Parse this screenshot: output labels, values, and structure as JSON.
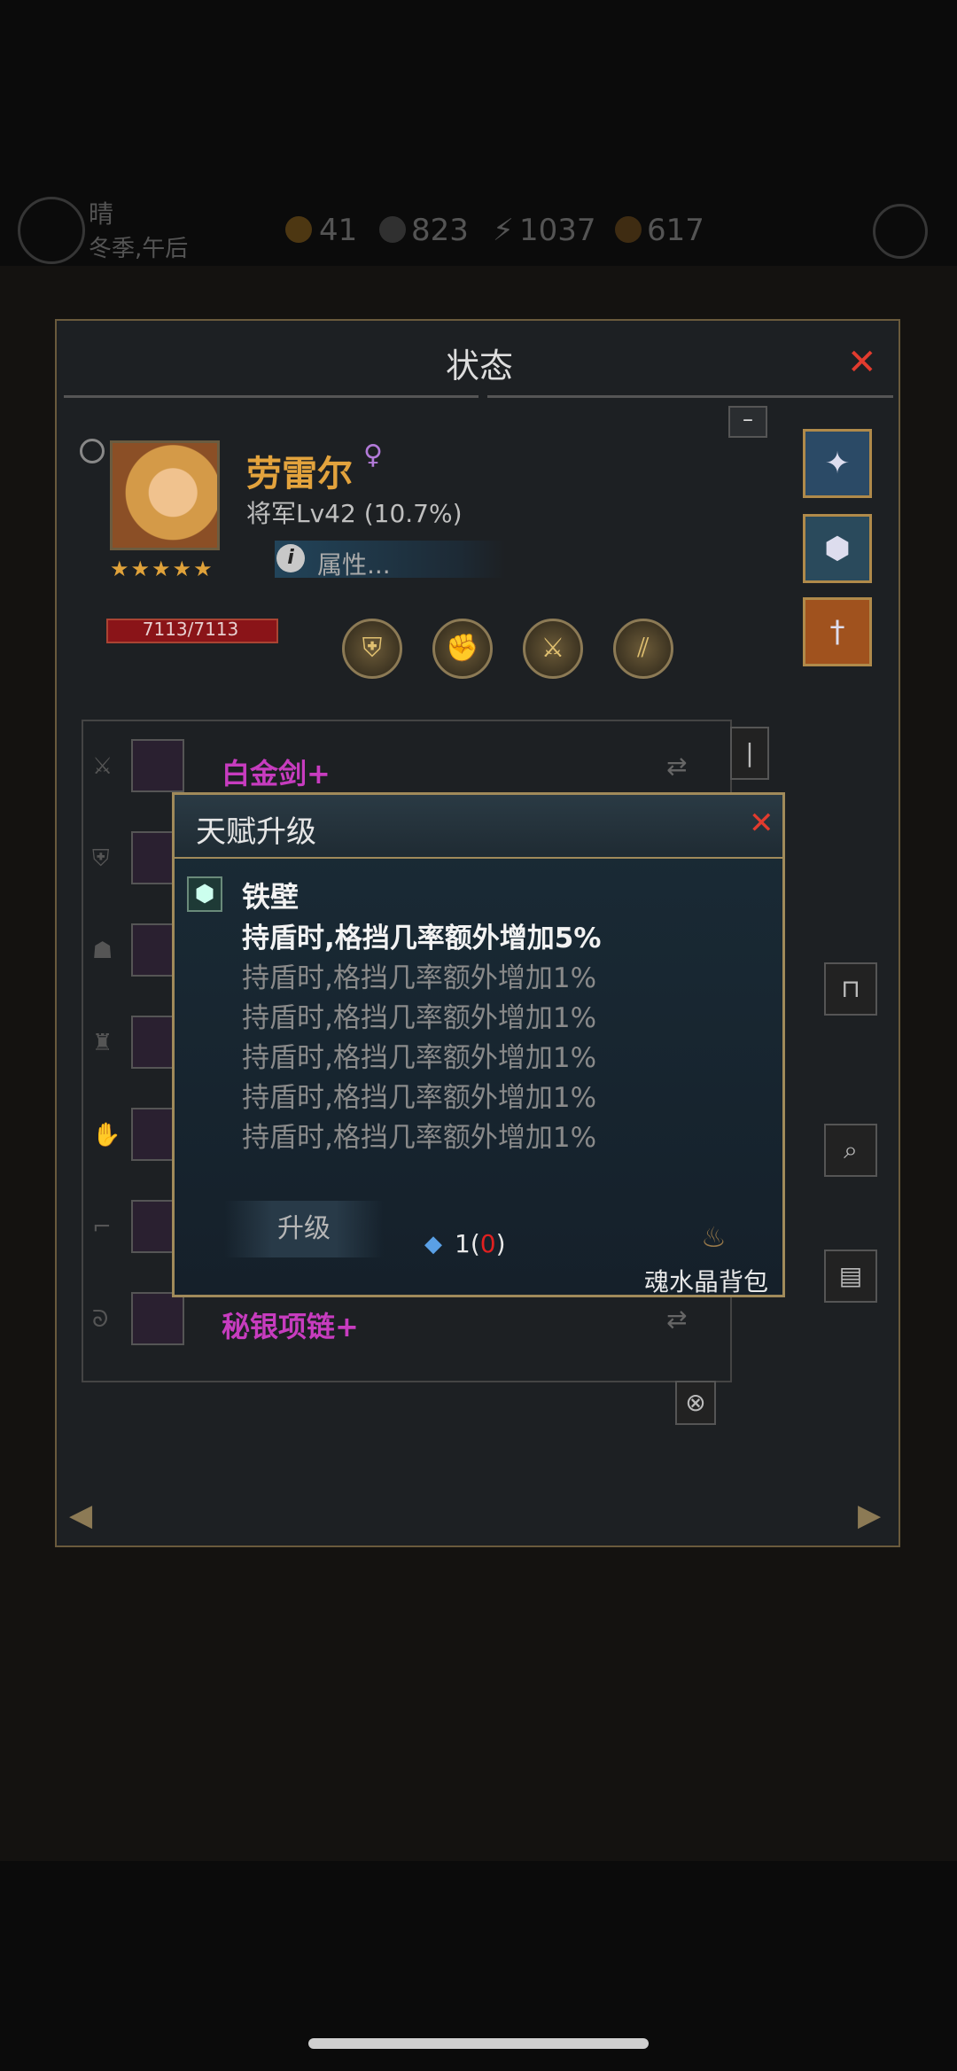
{
  "topbar": {
    "weather": "晴",
    "season": "冬季,午后",
    "resources": [
      "41",
      "823",
      "1037",
      "617"
    ]
  },
  "panel": {
    "title": "状态",
    "close": "✕",
    "minimize": "–",
    "nav_left": "◀",
    "nav_right": "▶"
  },
  "hero": {
    "name": "劳雷尔",
    "gender": "♀",
    "level": "将军Lv42 (10.7%)",
    "stars": "★★★★★",
    "attr_label": "属性...",
    "hp": "7113/7113"
  },
  "equipment": [
    {
      "slot": "sword",
      "name": "白金剑+"
    },
    {
      "slot": "shield",
      "name": ""
    },
    {
      "slot": "helmet",
      "name": ""
    },
    {
      "slot": "armor",
      "name": ""
    },
    {
      "slot": "gloves",
      "name": ""
    },
    {
      "slot": "boots",
      "name": ""
    },
    {
      "slot": "necklace",
      "name": "秘银项链+"
    }
  ],
  "dialog": {
    "title": "天赋升级",
    "close": "✕",
    "talent_name": "铁壁",
    "lines": [
      "持盾时,格挡几率额外增加5%",
      "持盾时,格挡几率额外增加1%",
      "持盾时,格挡几率额外增加1%",
      "持盾时,格挡几率额外增加1%",
      "持盾时,格挡几率额外增加1%",
      "持盾时,格挡几率额外增加1%"
    ],
    "upgrade_label": "升级",
    "cost_have": "1",
    "cost_open": "(",
    "cost_need": "0",
    "cost_close": ")",
    "bag_label": "魂水晶背包"
  },
  "colors": {
    "accent_gold": "#e3a33d",
    "equip_purple": "#c73cbf",
    "close_red": "#e23b2e"
  }
}
